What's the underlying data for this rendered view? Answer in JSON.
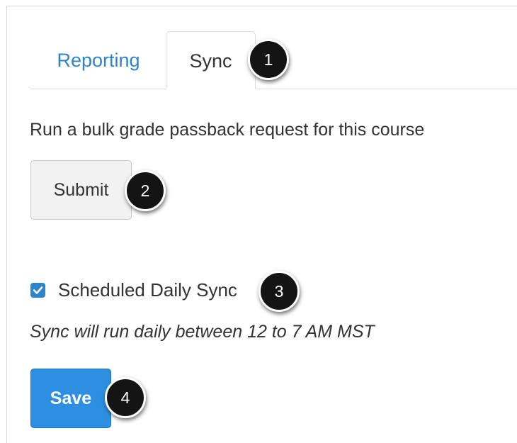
{
  "tabs": [
    {
      "label": "Reporting",
      "active": false
    },
    {
      "label": "Sync",
      "active": true
    }
  ],
  "sync": {
    "intro_text": "Run a bulk grade passback request for this course",
    "submit_label": "Submit",
    "scheduled_label": "Scheduled Daily Sync",
    "scheduled_checked": true,
    "schedule_note": "Sync will run daily between 12 to 7 AM MST",
    "save_label": "Save"
  },
  "callouts": [
    "1",
    "2",
    "3",
    "4"
  ],
  "colors": {
    "link": "#2d84c8",
    "primary_button": "#2d8fe0",
    "callout_bg": "#141414",
    "text": "#333333"
  }
}
